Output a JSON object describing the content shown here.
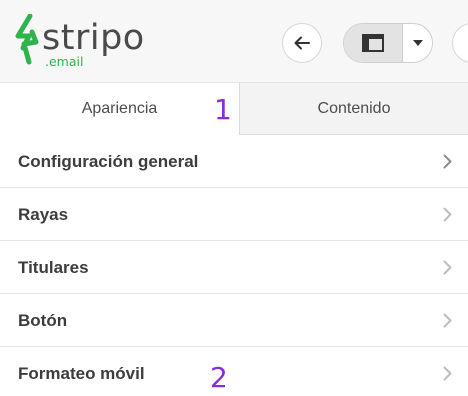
{
  "header": {
    "logo": {
      "word": "stripo",
      "sub": ".email"
    },
    "buttons": {
      "back_icon": "arrow-left-icon",
      "layout_icon": "layout-panel-icon",
      "dropdown_icon": "caret-down-icon"
    }
  },
  "tabs": [
    {
      "label": "Apariencia",
      "active": true
    },
    {
      "label": "Contenido",
      "active": false
    }
  ],
  "annotations": [
    "1",
    "2"
  ],
  "list": {
    "chevron_icon": "chevron-right-icon",
    "items": [
      {
        "label": "Configuración general"
      },
      {
        "label": "Rayas"
      },
      {
        "label": "Titulares"
      },
      {
        "label": "Botón"
      },
      {
        "label": "Formateo móvil"
      }
    ]
  },
  "colors": {
    "brand_green": "#2fb44c",
    "annotation_purple": "#8a2be2",
    "text": "#3d3d3d"
  }
}
